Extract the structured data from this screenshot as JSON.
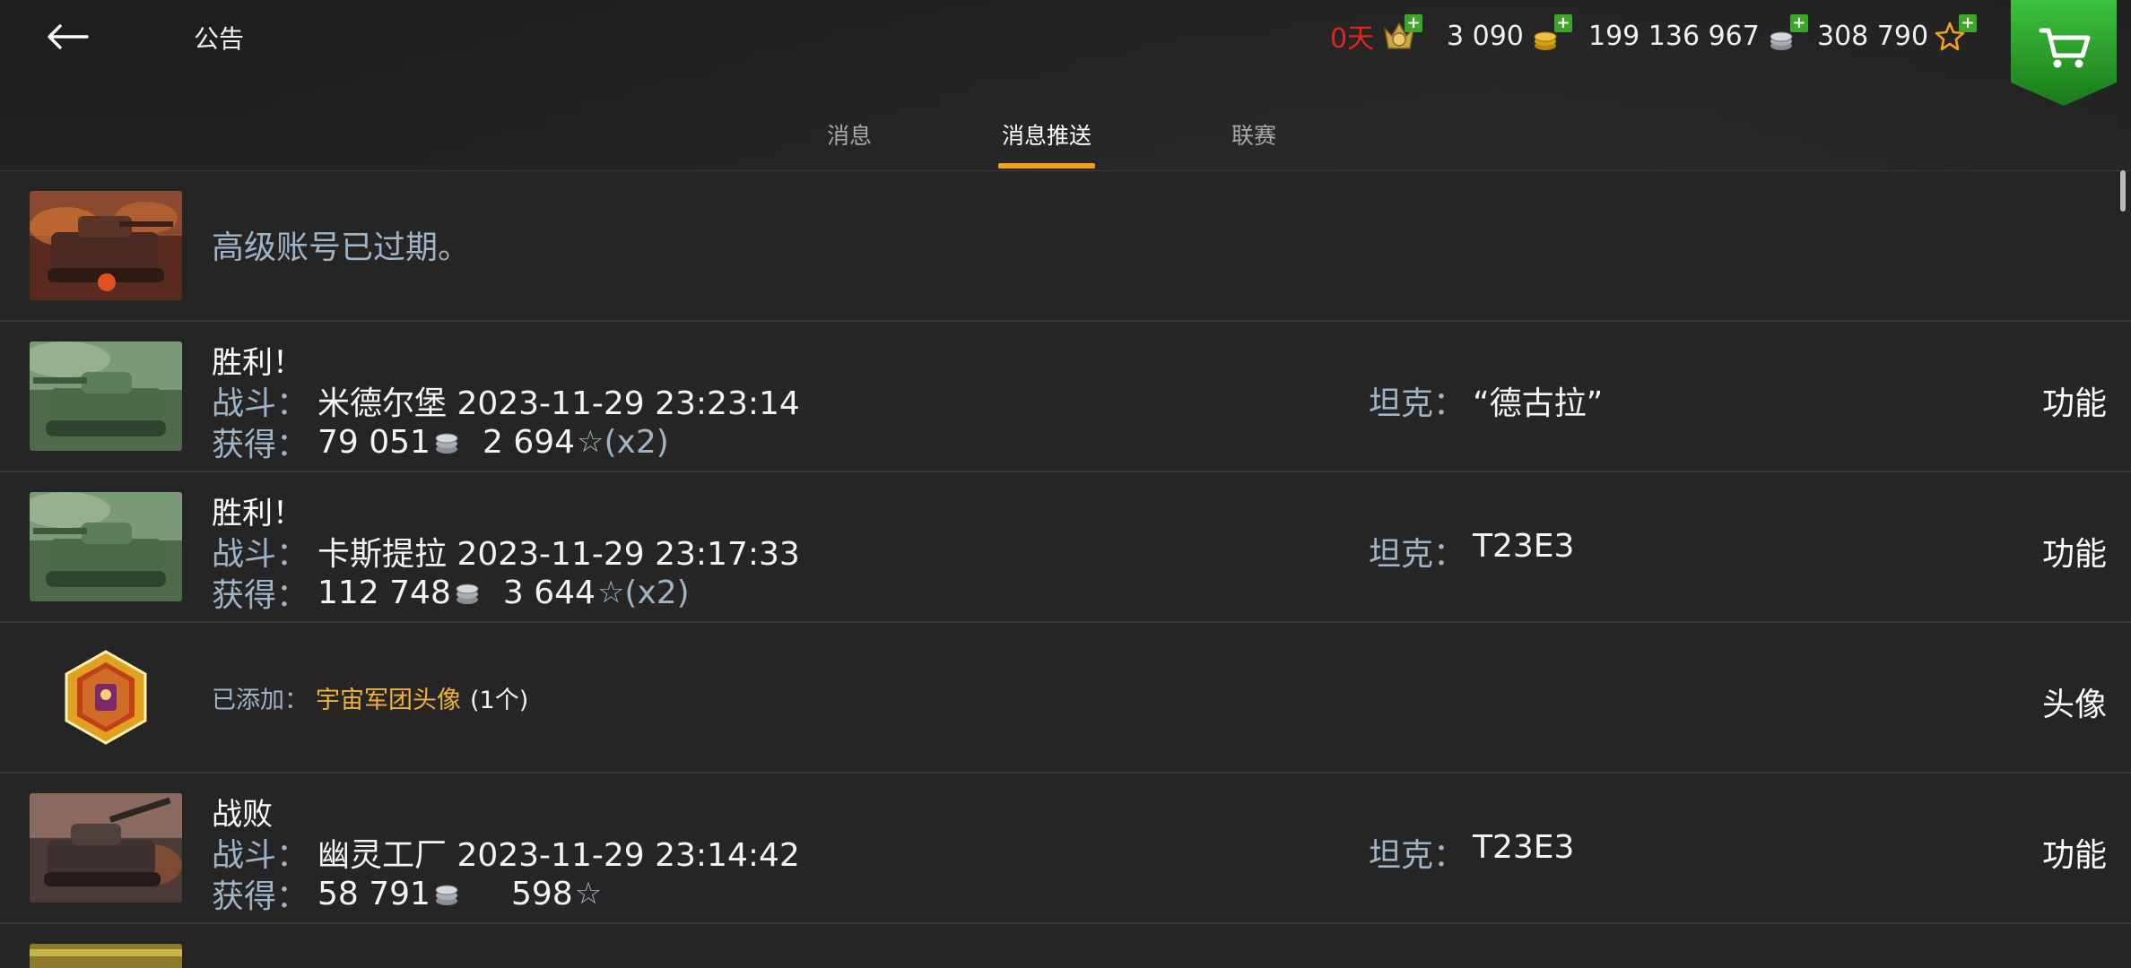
{
  "header": {
    "title": "公告",
    "premium_days": "0天",
    "gold": "3 090",
    "silver": "199 136 967",
    "free_xp": "308 790",
    "plus": "+"
  },
  "tabs": [
    {
      "label": "消息",
      "active": false
    },
    {
      "label": "消息推送",
      "active": true
    },
    {
      "label": "联赛",
      "active": false
    }
  ],
  "colors": {
    "accent": "#f0a020",
    "premium_red": "#e0261c",
    "label_blue": "#9fb4c7",
    "gold_text": "#f0b23a",
    "green": "#3fa52a"
  },
  "messages": [
    {
      "text": "高级账号已过期。"
    },
    {
      "title": "胜利！",
      "battle_label": "战斗：",
      "battle_value": "米德尔堡 2023-11-29 23:23:14",
      "earned_label": "获得：",
      "credits": "79 051",
      "xp": "2 694",
      "multiplier": "(x2)",
      "tank_label": "坦克：",
      "tank": "“德古拉”",
      "action": "功能"
    },
    {
      "title": "胜利！",
      "battle_label": "战斗：",
      "battle_value": "卡斯提拉 2023-11-29 23:17:33",
      "earned_label": "获得：",
      "credits": "112 748",
      "xp": "3 644",
      "multiplier": "(x2)",
      "tank_label": "坦克：",
      "tank": "T23E3",
      "action": "功能"
    },
    {
      "added_label": "已添加：",
      "item": "宇宙军团头像",
      "count": "(1个)",
      "action": "头像"
    },
    {
      "title": "战败",
      "battle_label": "战斗：",
      "battle_value": "幽灵工厂 2023-11-29 23:14:42",
      "earned_label": "获得：",
      "credits": "58 791",
      "xp": "598",
      "tank_label": "坦克：",
      "tank": "T23E3",
      "action": "功能"
    }
  ]
}
